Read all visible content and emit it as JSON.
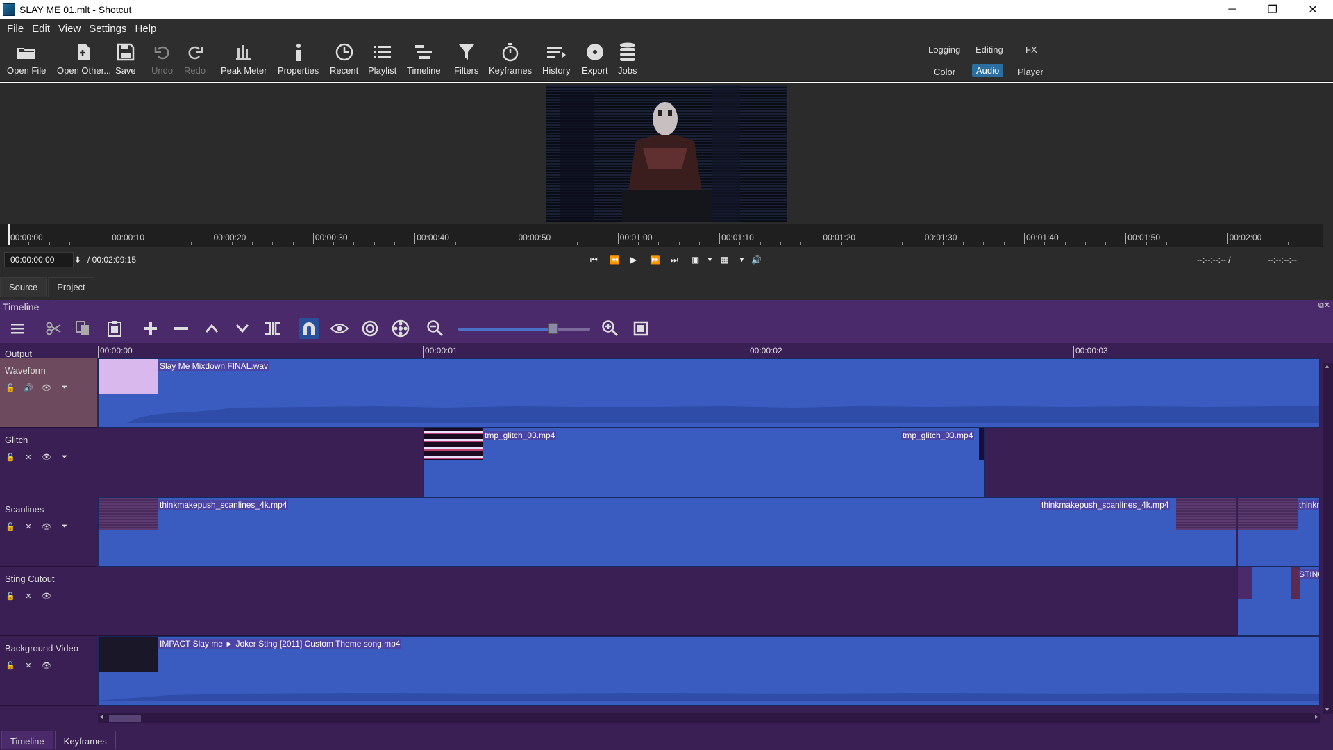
{
  "window": {
    "title": "SLAY ME 01.mlt - Shotcut",
    "controls": [
      "minimize",
      "maximize",
      "close"
    ]
  },
  "menu": [
    "File",
    "Edit",
    "View",
    "Settings",
    "Help"
  ],
  "toolbar": {
    "open_file": "Open File",
    "open_other": "Open Other...",
    "save": "Save",
    "undo": "Undo",
    "redo": "Redo",
    "peak_meter": "Peak Meter",
    "properties": "Properties",
    "recent": "Recent",
    "playlist": "Playlist",
    "timeline": "Timeline",
    "filters": "Filters",
    "keyframes": "Keyframes",
    "history": "History",
    "export": "Export",
    "jobs": "Jobs"
  },
  "layouts": {
    "logging": "Logging",
    "editing": "Editing",
    "fx": "FX",
    "color": "Color",
    "audio": "Audio",
    "player": "Player",
    "active": "Audio"
  },
  "player": {
    "ruler": [
      "00:00:00",
      "00:00:10",
      "00:00:20",
      "00:00:30",
      "00:00:40",
      "00:00:50",
      "00:01:00",
      "00:01:10",
      "00:01:20",
      "00:01:30",
      "00:01:40",
      "00:01:50",
      "00:02:00"
    ],
    "current_time": "00:00:00:00",
    "duration": "/ 00:02:09:15",
    "in_point": "--:--:--:-- /",
    "out_point": "--:--:--:--",
    "tabs": [
      "Source",
      "Project"
    ]
  },
  "timeline": {
    "panel_title": "Timeline",
    "ruler": [
      "00:00:00",
      "00:00:01",
      "00:00:02",
      "00:00:03"
    ],
    "output_label": "Output",
    "tracks": [
      {
        "name": "Waveform",
        "type": "audio"
      },
      {
        "name": "Glitch",
        "type": "video"
      },
      {
        "name": "Scanlines",
        "type": "video"
      },
      {
        "name": "Sting Cutout",
        "type": "video"
      },
      {
        "name": "Background Video",
        "type": "video"
      }
    ],
    "clips": {
      "waveform": "Slay Me Mixdown FINAL.wav",
      "glitch_a": "tmp_glitch_03.mp4",
      "glitch_b": "tmp_glitch_03.mp4",
      "scan_a": "thinkmakepush_scanlines_4k.mp4",
      "scan_b": "thinkmakepush_scanlines_4k.mp4",
      "scan_c": "thinkr",
      "sting": "STING",
      "background": "IMPACT Slay me ► Joker Sting [2011] Custom Theme song.mp4"
    },
    "zoom_level": 0.72
  },
  "bottom_tabs": [
    "Timeline",
    "Keyframes"
  ],
  "colors": {
    "accent": "#2a6fa0",
    "timeline_bg": "#3a1f55",
    "clip_blue": "#3a5cc0"
  }
}
